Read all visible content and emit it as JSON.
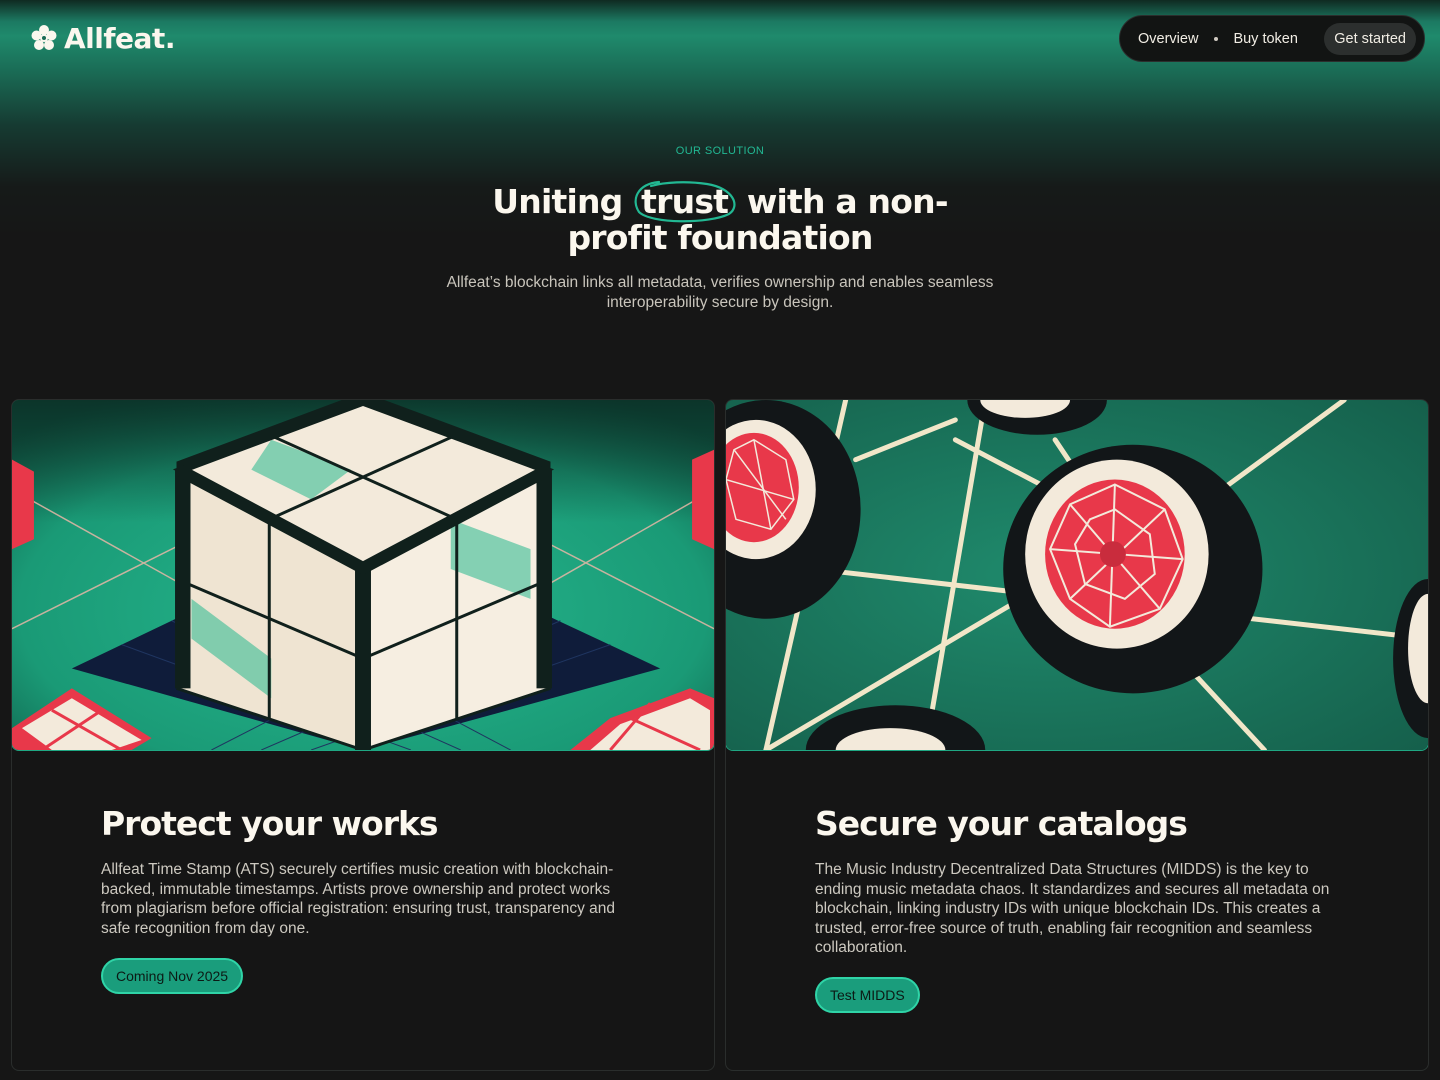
{
  "brand": {
    "name": "Allfeat.",
    "logo_icon": "flower-logo-icon"
  },
  "nav": {
    "items": [
      {
        "label": "Overview"
      },
      {
        "label": "Buy token"
      }
    ],
    "cta_label": "Get started"
  },
  "hero": {
    "eyebrow": "OUR SOLUTION",
    "headline_pre": "Uniting",
    "headline_highlight": "trust",
    "headline_post": "with a non-",
    "headline_line2": "profit foundation",
    "subhead": "Allfeat’s blockchain links all metadata, verifies ownership and enables seamless interoperability secure by design."
  },
  "cards": [
    {
      "title": "Protect your works",
      "description": "Allfeat Time Stamp (ATS) securely certifies music creation with blockchain-backed, immutable timestamps. Artists prove ownership and protect works from plagiarism before official registration: ensuring trust, transparency and safe recognition from day one.",
      "button_label": "Coming Nov 2025",
      "illustration": "glass-cube-illustration"
    },
    {
      "title": "Secure your catalogs",
      "description": "The Music Industry Decentralized Data Structures (MIDDS) is the key to ending music metadata chaos. It standardizes and secures all metadata on blockchain, linking industry IDs with unique blockchain IDs. This creates a trusted, error-free source of truth, enabling fair recognition and seamless collaboration.",
      "button_label": "Test MIDDS",
      "illustration": "network-nodes-illustration"
    }
  ],
  "colors": {
    "accent": "#22b893",
    "button_bg": "#1a9d7c",
    "background": "#161616",
    "illustration_green": "#1f9a78",
    "illustration_red": "#e8384a"
  }
}
